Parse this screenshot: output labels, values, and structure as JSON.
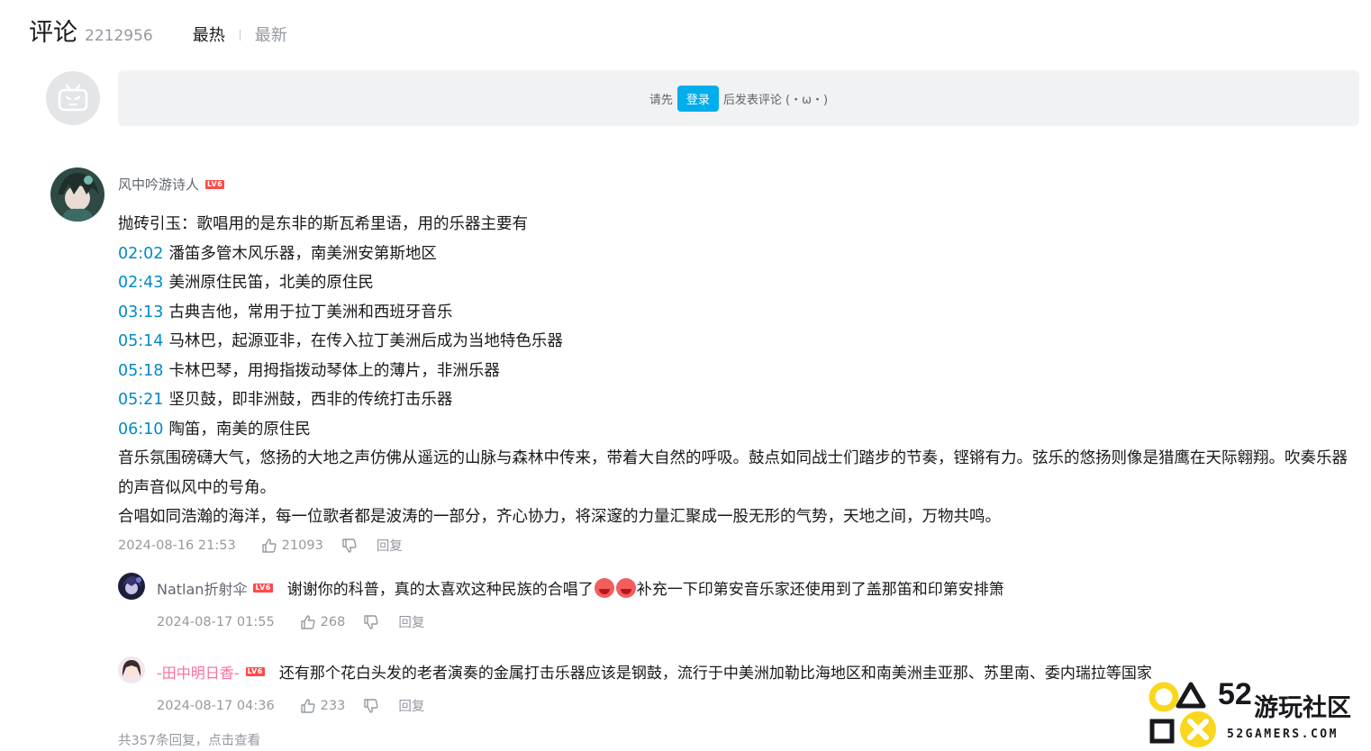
{
  "header": {
    "title": "评论",
    "count": "2212956",
    "tab_hot": "最热",
    "tab_new": "最新"
  },
  "login": {
    "prefix": "请先",
    "button": "登录",
    "suffix": "后发表评论 (・ω・)"
  },
  "comment": {
    "username": "风中吟游诗人",
    "level": "LV6",
    "lines": [
      {
        "text": "抛砖引玉：歌唱用的是东非的斯瓦希里语，用的乐器主要有"
      },
      {
        "ts": "02:02",
        "text": "潘笛多管木风乐器，南美洲安第斯地区"
      },
      {
        "ts": "02:43",
        "text": "美洲原住民笛，北美的原住民"
      },
      {
        "ts": "03:13",
        "text": "古典吉他，常用于拉丁美洲和西班牙音乐"
      },
      {
        "ts": "05:14",
        "text": "马林巴，起源亚非，在传入拉丁美洲后成为当地特色乐器"
      },
      {
        "ts": "05:18",
        "text": "卡林巴琴，用拇指拨动琴体上的薄片，非洲乐器"
      },
      {
        "ts": "05:21",
        "text": "坚贝鼓，即非洲鼓，西非的传统打击乐器"
      },
      {
        "ts": "06:10",
        "text": "陶笛，南美的原住民"
      }
    ],
    "paragraph1": "音乐氛围磅礴大气，悠扬的大地之声仿佛从遥远的山脉与森林中传来，带着大自然的呼吸。鼓点如同战士们踏步的节奏，铿锵有力。弦乐的悠扬则像是猎鹰在天际翱翔。吹奏乐器的声音似风中的号角。",
    "paragraph2": "合唱如同浩瀚的海洋，每一位歌者都是波涛的一部分，齐心协力，将深邃的力量汇聚成一股无形的气势，天地之间，万物共鸣。",
    "time": "2024-08-16 21:53",
    "likes": "21093",
    "reply_label": "回复"
  },
  "replies": [
    {
      "username": "Natlan折射伞",
      "level": "LV6",
      "text_before": "谢谢你的科普，真的太喜欢这种民族的合唱了",
      "text_after": "补充一下印第安音乐家还使用到了盖那笛和印第安排箫",
      "time": "2024-08-17 01:55",
      "likes": "268",
      "reply_label": "回复"
    },
    {
      "username": "-田中明日香-",
      "level": "LV6",
      "text": "还有那个花白头发的老者演奏的金属打击乐器应该是钢鼓，流行于中美洲加勒比海地区和南美洲圭亚那、苏里南、委内瑞拉等国家",
      "time": "2024-08-17 04:36",
      "likes": "233",
      "reply_label": "回复"
    }
  ],
  "more_replies": "共357条回复，点击查看",
  "watermark": {
    "number": "52",
    "name": "游玩社区",
    "domain": "52GAMERS.COM"
  },
  "colors": {
    "accent": "#00aeec",
    "timestamp": "#008ac5",
    "level_badge": "#ff4a4a",
    "pink_name": "#fb7299",
    "watermark_yellow": "#f9d71c"
  }
}
